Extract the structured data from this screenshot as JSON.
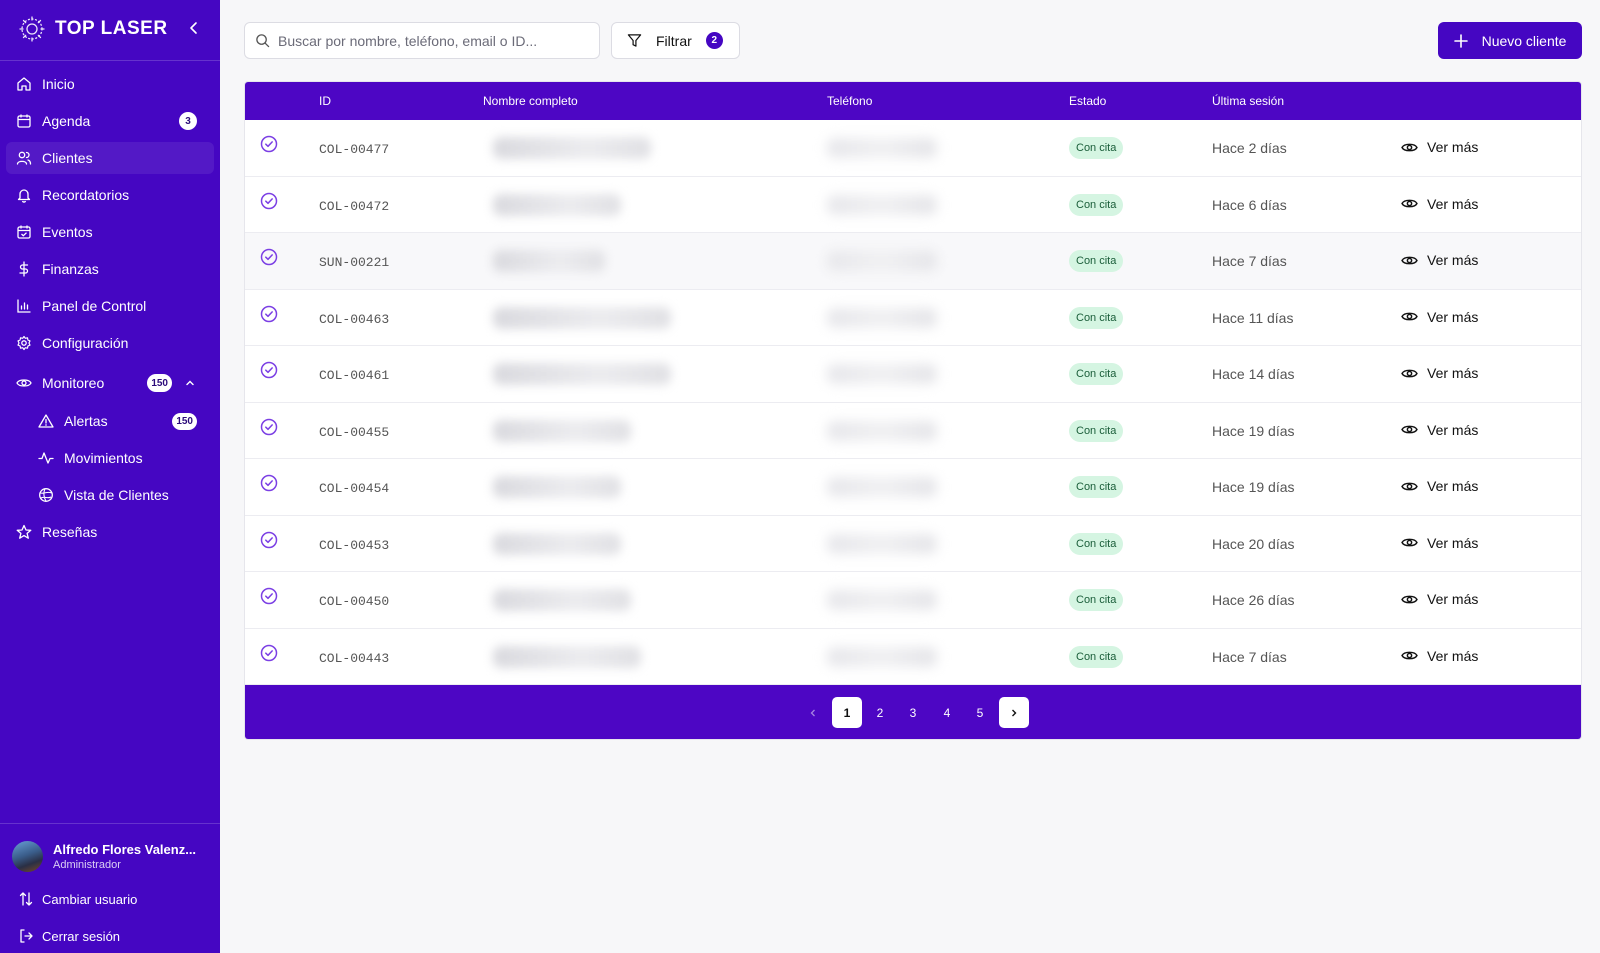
{
  "brand": {
    "name": "TOP LASER"
  },
  "sidebar": {
    "items": [
      {
        "label": "Inicio",
        "icon": "home-icon"
      },
      {
        "label": "Agenda",
        "icon": "calendar-icon",
        "badge": "3"
      },
      {
        "label": "Clientes",
        "icon": "users-icon",
        "active": true
      },
      {
        "label": "Recordatorios",
        "icon": "bell-icon"
      },
      {
        "label": "Eventos",
        "icon": "calendar-check-icon"
      },
      {
        "label": "Finanzas",
        "icon": "dollar-icon"
      },
      {
        "label": "Panel de Control",
        "icon": "bar-chart-icon"
      },
      {
        "label": "Configuración",
        "icon": "gear-icon"
      },
      {
        "label": "Monitoreo",
        "icon": "eye-icon",
        "badge": "150",
        "expanded": true
      }
    ],
    "subitems": [
      {
        "label": "Alertas",
        "icon": "alert-triangle-icon",
        "badge": "150"
      },
      {
        "label": "Movimientos",
        "icon": "activity-icon"
      },
      {
        "label": "Vista de Clientes",
        "icon": "globe-icon"
      }
    ],
    "after": [
      {
        "label": "Reseñas",
        "icon": "star-icon"
      }
    ]
  },
  "user": {
    "name": "Alfredo Flores Valenz...",
    "role": "Administrador",
    "switch_label": "Cambiar usuario",
    "logout_label": "Cerrar sesión"
  },
  "toolbar": {
    "search_placeholder": "Buscar por nombre, teléfono, email o ID...",
    "filter_label": "Filtrar",
    "filter_count": "2",
    "new_label": "Nuevo cliente"
  },
  "table": {
    "headers": {
      "id": "ID",
      "name": "Nombre completo",
      "phone": "Teléfono",
      "status": "Estado",
      "last": "Última sesión"
    },
    "rows": [
      {
        "id": "COL-00477",
        "status": "Con cita",
        "last": "Hace 2 días",
        "action": "Ver más"
      },
      {
        "id": "COL-00472",
        "status": "Con cita",
        "last": "Hace 6 días",
        "action": "Ver más"
      },
      {
        "id": "SUN-00221",
        "status": "Con cita",
        "last": "Hace 7 días",
        "action": "Ver más"
      },
      {
        "id": "COL-00463",
        "status": "Con cita",
        "last": "Hace 11 días",
        "action": "Ver más"
      },
      {
        "id": "COL-00461",
        "status": "Con cita",
        "last": "Hace 14 días",
        "action": "Ver más"
      },
      {
        "id": "COL-00455",
        "status": "Con cita",
        "last": "Hace 19 días",
        "action": "Ver más"
      },
      {
        "id": "COL-00454",
        "status": "Con cita",
        "last": "Hace 19 días",
        "action": "Ver más"
      },
      {
        "id": "COL-00453",
        "status": "Con cita",
        "last": "Hace 20 días",
        "action": "Ver más"
      },
      {
        "id": "COL-00450",
        "status": "Con cita",
        "last": "Hace 26 días",
        "action": "Ver más"
      },
      {
        "id": "COL-00443",
        "status": "Con cita",
        "last": "Hace 7 días",
        "action": "Ver más"
      }
    ]
  },
  "pagination": {
    "pages": [
      "1",
      "2",
      "3",
      "4",
      "5"
    ],
    "current": "1"
  },
  "colors": {
    "primary": "#4506c2",
    "header": "#4d06c4",
    "status_bg": "#d5f5e2",
    "status_text": "#1b5e3a",
    "check": "#7b3fe4"
  }
}
